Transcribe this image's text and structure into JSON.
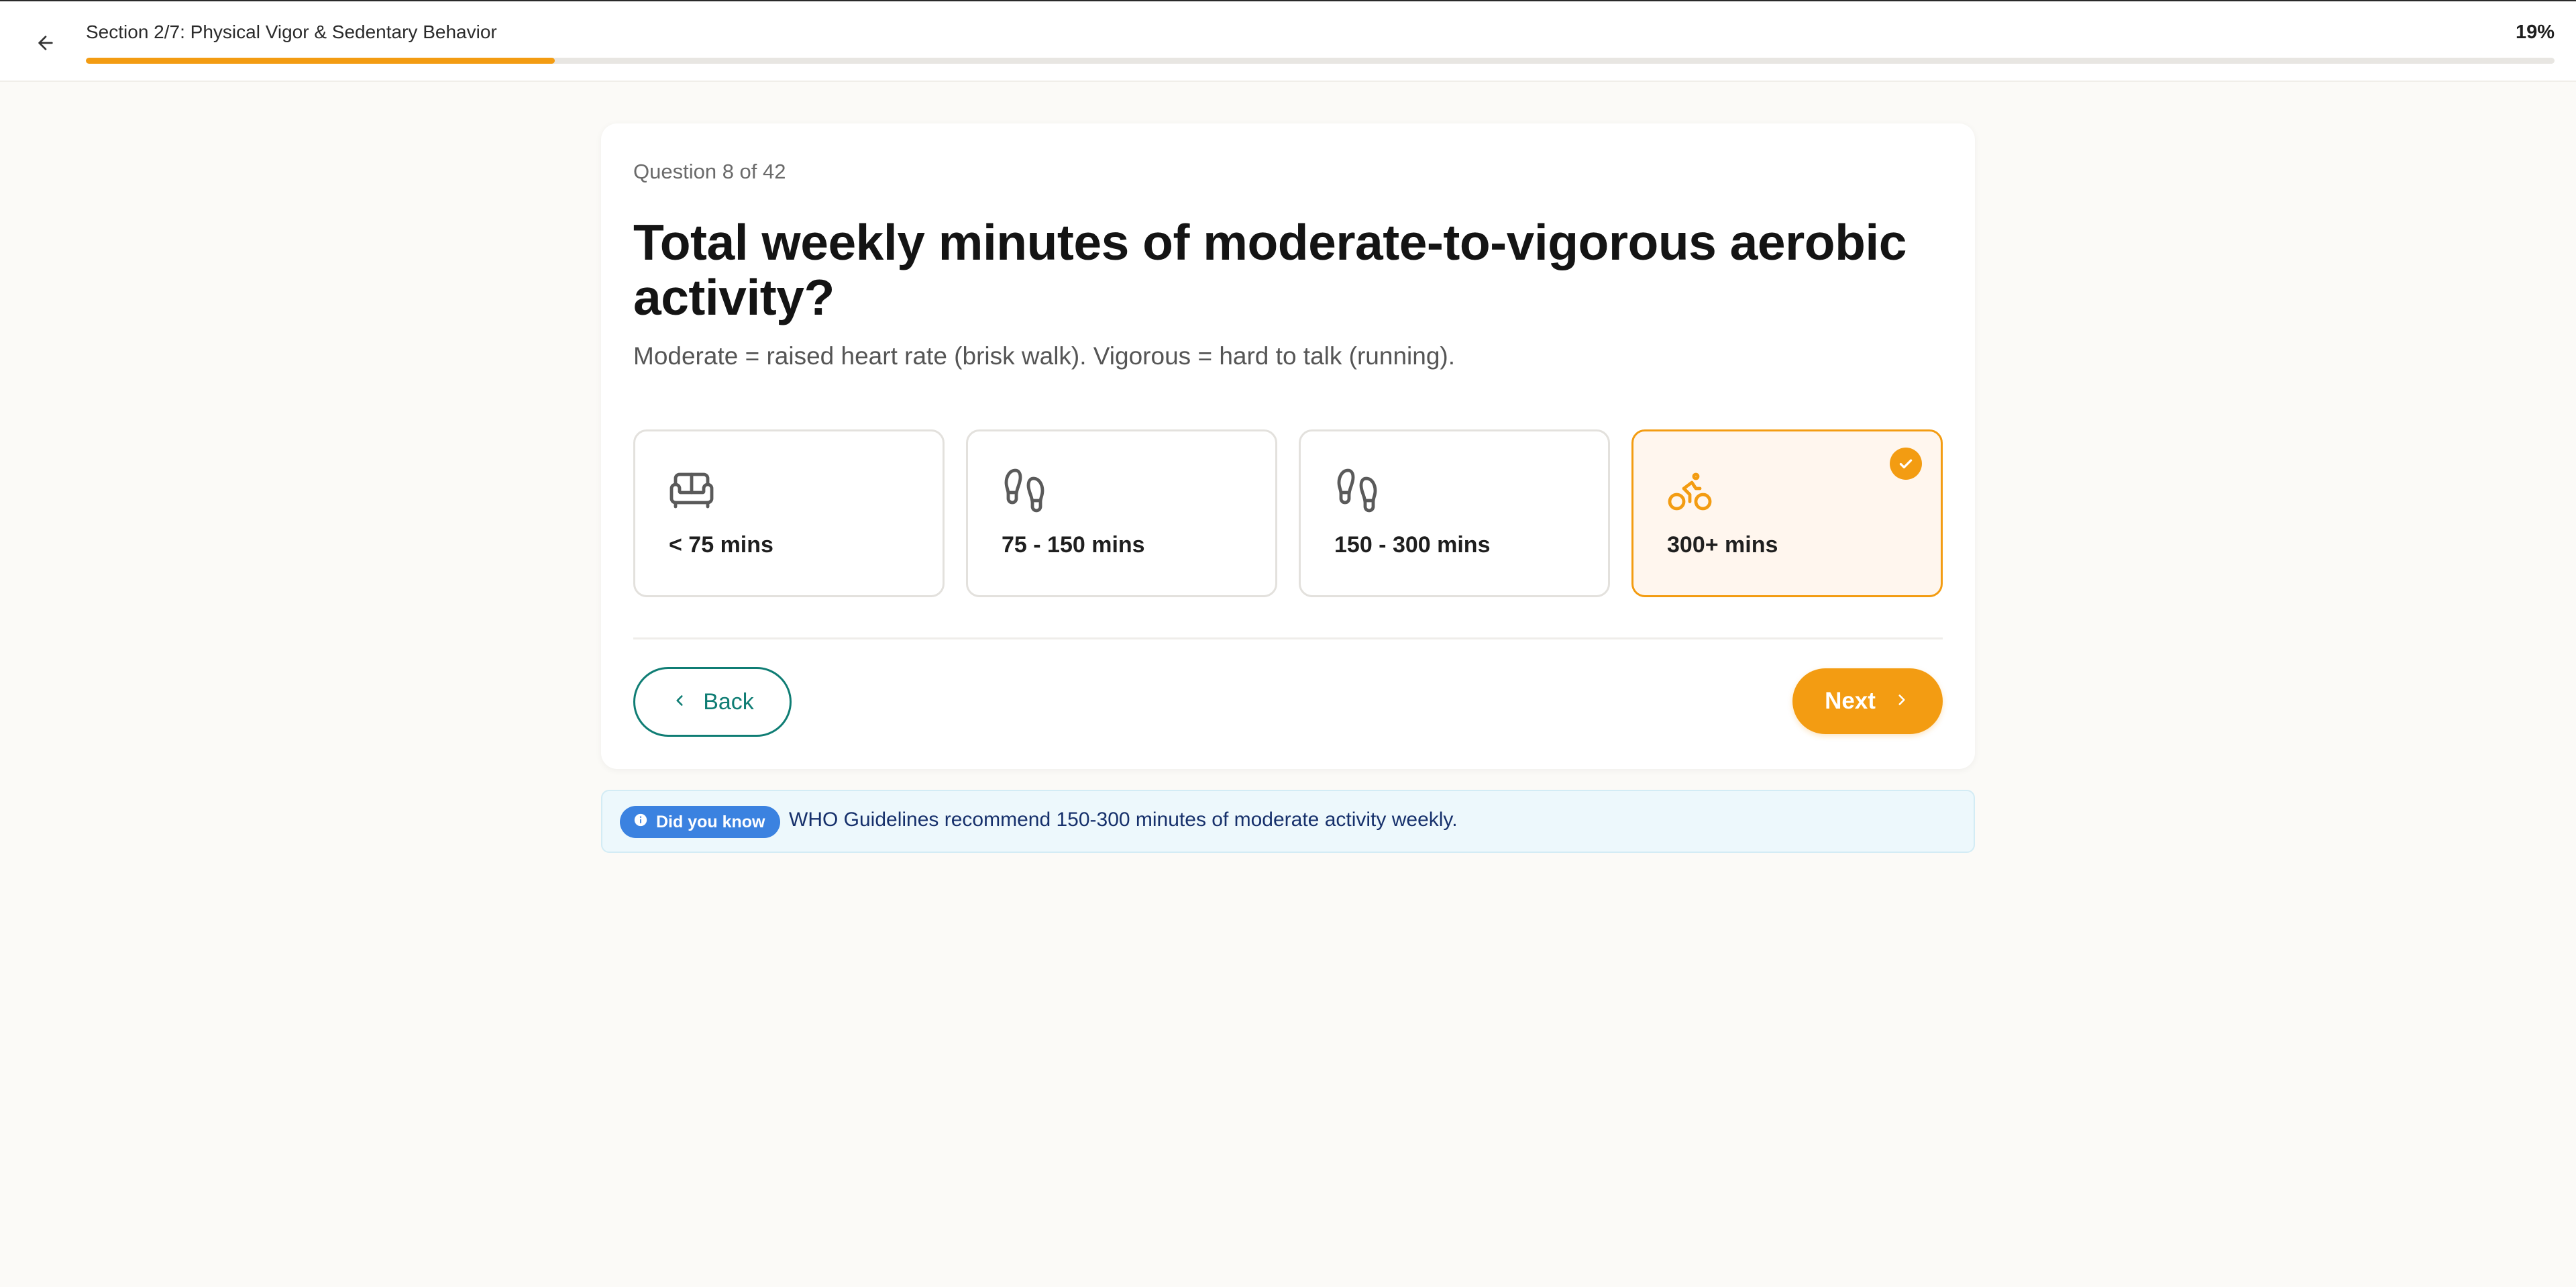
{
  "header": {
    "back_icon": "arrow-left-icon",
    "section_title": "Section 2/7: Physical Vigor & Sedentary Behavior",
    "progress_percent_label": "19%",
    "progress_fraction": 0.19,
    "accent_color": "#f39c12"
  },
  "question": {
    "counter": "Question 8 of 42",
    "title": "Total weekly minutes of moderate-to-vigorous aerobic activity?",
    "subtitle": "Moderate = raised heart rate (brisk walk). Vigorous = hard to talk (running)."
  },
  "options": [
    {
      "label": "< 75 mins",
      "icon": "sofa-icon",
      "selected": false
    },
    {
      "label": "75 - 150 mins",
      "icon": "footprints-icon",
      "selected": false
    },
    {
      "label": "150 - 300 mins",
      "icon": "footprints-icon",
      "selected": false
    },
    {
      "label": "300+ mins",
      "icon": "bicycle-icon",
      "selected": true
    }
  ],
  "nav": {
    "back_label": "Back",
    "next_label": "Next",
    "back_color": "#0f7d74"
  },
  "tip": {
    "badge": "Did you know",
    "badge_icon": "info-icon",
    "text": "WHO Guidelines recommend 150-300 minutes of moderate activity weekly."
  }
}
